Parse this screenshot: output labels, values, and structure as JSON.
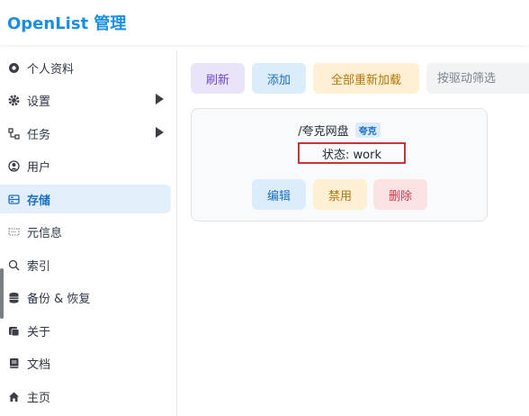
{
  "header": {
    "title": "OpenList 管理"
  },
  "sidebar": {
    "items": [
      {
        "label": "个人资料",
        "icon": "gear-badge-icon"
      },
      {
        "label": "设置",
        "icon": "gear-icon"
      },
      {
        "label": "任务",
        "icon": "flow-icon"
      },
      {
        "label": "用户",
        "icon": "user-circle-icon"
      },
      {
        "label": "存储",
        "icon": "storage-icon"
      },
      {
        "label": "元信息",
        "icon": "meta-icon"
      },
      {
        "label": "索引",
        "icon": "search-icon"
      },
      {
        "label": "备份 & 恢复",
        "icon": "database-icon"
      },
      {
        "label": "关于",
        "icon": "info-box-icon"
      },
      {
        "label": "文档",
        "icon": "book-icon"
      },
      {
        "label": "主页",
        "icon": "home-icon"
      }
    ],
    "active": "存储"
  },
  "toolbar": {
    "refresh_label": "刷新",
    "add_label": "添加",
    "reload_all_label": "全部重新加载",
    "filter_placeholder": "按驱动筛选"
  },
  "storage_card": {
    "mount_path": "/夸克网盘",
    "driver_badge": "夸克",
    "status_text": "状态: work",
    "edit_label": "编辑",
    "disable_label": "禁用",
    "delete_label": "删除"
  },
  "colors": {
    "brand": "#1a8ee6",
    "active_nav_bg": "#e3f0fc",
    "status_border": "#c8343b"
  }
}
